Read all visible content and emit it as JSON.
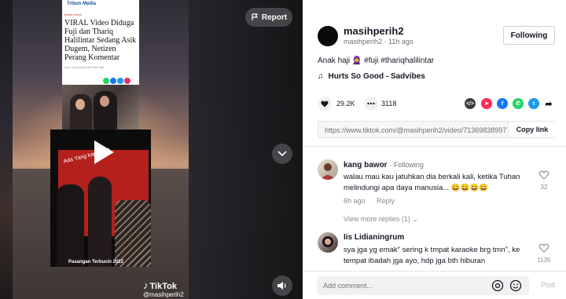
{
  "video": {
    "report_label": "Report",
    "news": {
      "logo": "Tribun Media",
      "tag": "Berita Seleb",
      "headline": "VIRAL Video Diduga Fuji dan Thariq Halilintar Sedang Asik Dugem, Netizen Perang Komentar",
      "meta": "Kamis, 29 Desember 2022 19:07 WIB"
    },
    "club_caption_top": "Ada Yang kaget???",
    "club_caption_bottom": "Pasangan Terbucin 2022",
    "watermark_brand": "TikTok",
    "watermark_user": "@masihperih2"
  },
  "author": {
    "username": "masihperih2",
    "handle": "masihperih2",
    "time_ago": "11h ago",
    "follow_label": "Following"
  },
  "post": {
    "caption": "Anak haji 🧕 #fuji #thariqhalilintar",
    "music": "Hurts So Good - Sadvibes",
    "likes": "29.2K",
    "comments": "3118",
    "link": "https://www.tiktok.com/@masihperih2/video/71369838997...",
    "copy_link_label": "Copy link"
  },
  "comments": [
    {
      "user": "kang bawor",
      "badge": "· Following",
      "text": "walau mau kau jatuhkan dia berkali kali, ketika Tuhan melindungi apa daya manusia... 😀😀😀😀",
      "time": "6h ago",
      "reply_label": "Reply",
      "likes": "32"
    },
    {
      "user": "Iis Lidianingrum",
      "badge": "",
      "text": "sya jga yg emak\" sering k tmpat karaoke brg tmn\", ke tempat ibadah jga ayo, hdp jga bth hiburan",
      "likes": "1135"
    }
  ],
  "view_more_replies": "View more replies (1)",
  "comment_input": {
    "placeholder": "Add comment...",
    "post_label": "Post"
  },
  "colors": {
    "accent_red": "#fe2c55",
    "text_primary": "#161823",
    "text_secondary": "#6f7078"
  }
}
